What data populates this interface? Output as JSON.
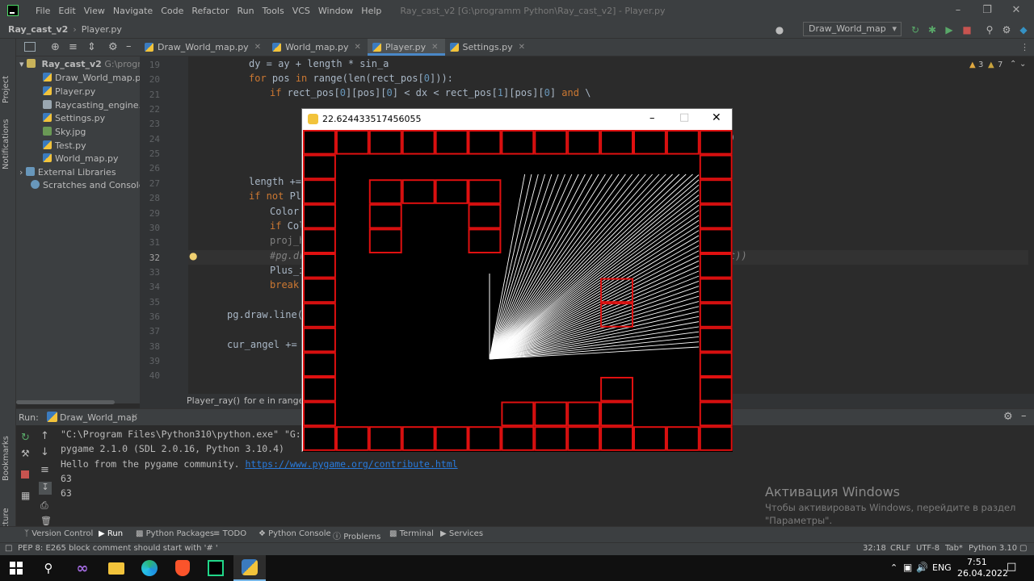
{
  "titlebar": {
    "menu": [
      "File",
      "Edit",
      "View",
      "Navigate",
      "Code",
      "Refactor",
      "Run",
      "Tools",
      "VCS",
      "Window",
      "Help"
    ],
    "window_title": "Ray_cast_v2 [G:\\programm Python\\Ray_cast_v2] - Player.py"
  },
  "navbar": {
    "project": "Ray_cast_v2",
    "file": "Player.py",
    "run_config": "Draw_World_map"
  },
  "left_stripe": {
    "project_label": "Project",
    "notifications_label": "Notifications",
    "bookmarks_label": "Bookmarks",
    "structure_label": "Structure"
  },
  "project_tree": {
    "root": "Ray_cast_v2",
    "root_path": "G:\\programm",
    "files": [
      "Draw_World_map.py",
      "Player.py",
      "Raycasting_engine.zip",
      "Settings.py",
      "Sky.jpg",
      "Test.py",
      "World_map.py"
    ],
    "external": "External Libraries",
    "scratches": "Scratches and Consoles"
  },
  "tabs": [
    "Draw_World_map.py",
    "World_map.py",
    "Player.py",
    "Settings.py"
  ],
  "active_tab": "Player.py",
  "inspections": {
    "warnings": "3",
    "weak_warnings": "7"
  },
  "code": {
    "line_numbers": [
      "19",
      "20",
      "21",
      "22",
      "23",
      "24",
      "25",
      "26",
      "27",
      "28",
      "29",
      "30",
      "31",
      "32",
      "33",
      "34",
      "35",
      "36",
      "37",
      "38",
      "39",
      "40"
    ],
    "current_line": "32",
    "lines": {
      "l19": "dy = ay + length * sin_a",
      "l20a": "for",
      "l20b": " pos ",
      "l20c": "in",
      "l20d": " range(len(rect_pos[",
      "l20e": "0",
      "l20f": "])):",
      "l21a": "if",
      "l21b": " rect_pos[",
      "l21c": "0",
      "l21d": "][pos][",
      "l21e": "0",
      "l21f": "] < dx < rect_pos[",
      "l21g": "1",
      "l21h": "][pos][",
      "l21i": "0",
      "l21j": "] ",
      "l21k": "and",
      "l21l": " \\",
      "l24_tail": ")",
      "l27": "length +=",
      "l28a": "if not",
      "l28b": " Plu",
      "l29": "Color",
      "l30a": "if",
      "l30b": " Col",
      "l31": "proj_h",
      "l32": "#pg.dr",
      "l32_tail": "t))",
      "l33": "Plus_i",
      "l34": "break",
      "l36": "pg.draw.line(s",
      "l38": "cur_angel += d"
    }
  },
  "editor_breadcrumbs": [
    "Player_ray()",
    "for e in range(R"
  ],
  "run_panel": {
    "label": "Run:",
    "config": "Draw_World_map",
    "console": {
      "line1": "\"C:\\Program Files\\Python310\\python.exe\" \"G:/p",
      "line2": "pygame 2.1.0 (SDL 2.0.16, Python 3.10.4)",
      "line3_text": "Hello from the pygame community. ",
      "line3_link": "https://www.pygame.org/contribute.html",
      "line4": "63",
      "line5": "63"
    }
  },
  "bottom_tools": [
    "Version Control",
    "Run",
    "Python Packages",
    "TODO",
    "Python Console",
    "Problems",
    "Terminal",
    "Services"
  ],
  "status_bar": {
    "message": "PEP 8: E265 block comment should start with '# '",
    "position": "32:18",
    "line_sep": "CRLF",
    "encoding": "UTF-8",
    "indent": "Tab*",
    "interpreter": "Python 3.10"
  },
  "activation": {
    "title": "Активация Windows",
    "line1": "Чтобы активировать Windows, перейдите в раздел",
    "line2": "\"Параметры\"."
  },
  "taskbar": {
    "lang": "ENG",
    "time": "7:51",
    "date": "26.04.2022"
  },
  "pygame_window": {
    "title": "22.624433517456055",
    "wall_color": "#e01010",
    "ray_color": "#ffffff",
    "ray_count": 63
  },
  "colors": {
    "accent": "#4a88c7",
    "keyword": "#cc7832",
    "comment": "#808080"
  }
}
